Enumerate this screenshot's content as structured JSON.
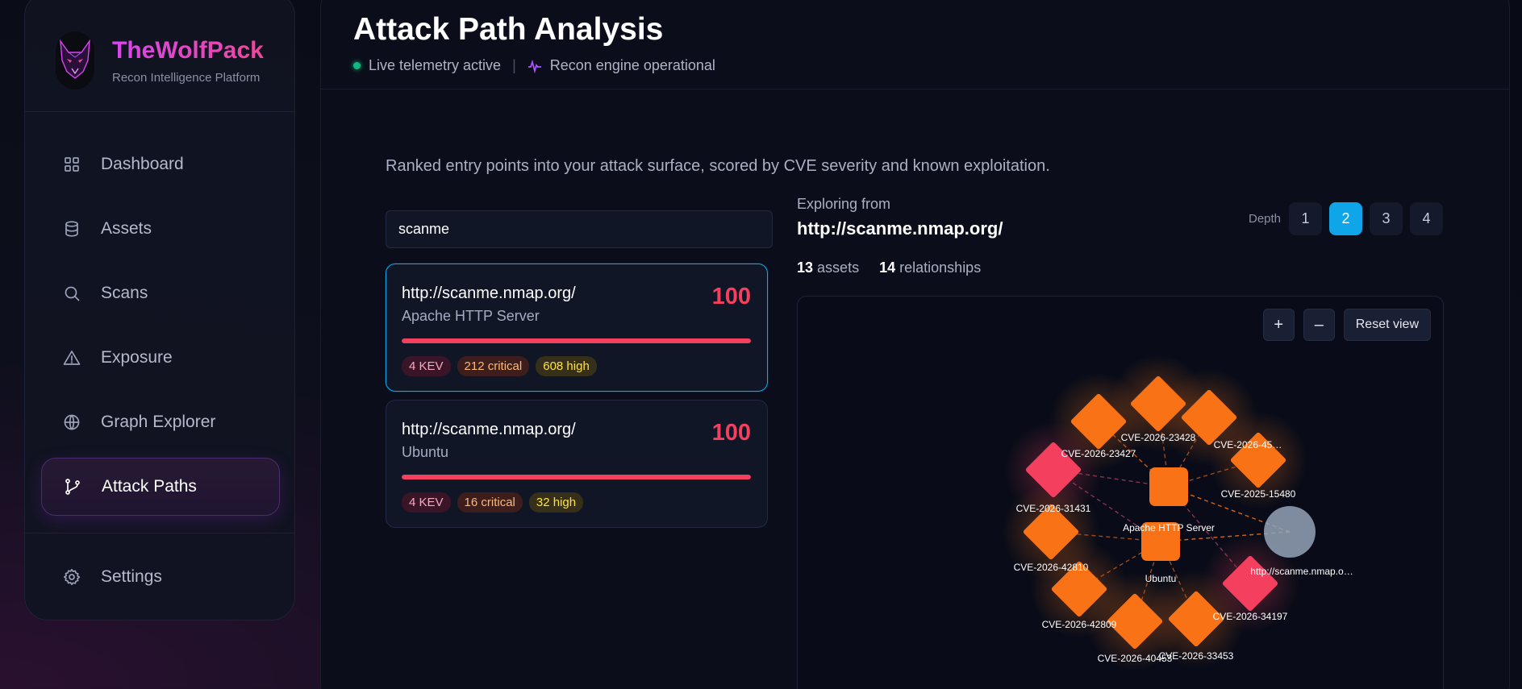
{
  "brand": {
    "name": "TheWolfPack",
    "tagline": "Recon Intelligence Platform"
  },
  "sidebar": {
    "items": [
      {
        "label": "Dashboard",
        "icon": "grid-icon"
      },
      {
        "label": "Assets",
        "icon": "database-icon"
      },
      {
        "label": "Scans",
        "icon": "search-icon"
      },
      {
        "label": "Exposure",
        "icon": "warning-icon"
      },
      {
        "label": "Graph Explorer",
        "icon": "globe-icon"
      },
      {
        "label": "Attack Paths",
        "icon": "git-branch-icon",
        "active": true
      }
    ],
    "settings": {
      "label": "Settings",
      "icon": "gear-icon"
    }
  },
  "header": {
    "title": "Attack Path Analysis",
    "status_live": "Live telemetry active",
    "separator": "|",
    "status_engine": "Recon engine operational"
  },
  "main": {
    "subtitle": "Ranked entry points into your attack surface, scored by CVE severity and known exploitation.",
    "search": {
      "value": "scanme",
      "placeholder": ""
    },
    "paths": [
      {
        "url": "http://scanme.nmap.org/",
        "tech": "Apache HTTP Server",
        "score": "100",
        "score_fraction": 1.0,
        "kev": "4 KEV",
        "critical": "212 critical",
        "high": "608 high",
        "selected": true
      },
      {
        "url": "http://scanme.nmap.org/",
        "tech": "Ubuntu",
        "score": "100",
        "score_fraction": 1.0,
        "kev": "4 KEV",
        "critical": "16 critical",
        "high": "32 high",
        "selected": false
      }
    ]
  },
  "explorer": {
    "label": "Exploring from",
    "url": "http://scanme.nmap.org/",
    "depth_label": "Depth",
    "depths": [
      "1",
      "2",
      "3",
      "4"
    ],
    "selected_depth": "2",
    "assets_count": "13",
    "assets_label": "assets",
    "relationships_count": "14",
    "relationships_label": "relationships",
    "controls": {
      "zoom_in": "+",
      "zoom_out": "–",
      "reset": "Reset view"
    }
  },
  "graph": {
    "colors": {
      "cve": "#f97316",
      "kev": "#f43f5e",
      "root": "#94a3b8",
      "edge": "#f97316"
    },
    "nodes": [
      {
        "id": "apache",
        "label": "Apache HTTP Server",
        "kind": "tech"
      },
      {
        "id": "ubuntu",
        "label": "Ubuntu",
        "kind": "tech"
      },
      {
        "id": "root",
        "label": "http://scanme.nmap.o…",
        "kind": "root"
      },
      {
        "id": "c23428",
        "label": "CVE-2026-23428",
        "kind": "cve"
      },
      {
        "id": "c23427",
        "label": "CVE-2026-23427",
        "kind": "cve"
      },
      {
        "id": "c45",
        "label": "CVE-2026-45…",
        "kind": "cve"
      },
      {
        "id": "c15480",
        "label": "CVE-2025-15480",
        "kind": "cve"
      },
      {
        "id": "c31431",
        "label": "CVE-2026-31431",
        "kind": "kev"
      },
      {
        "id": "c42810",
        "label": "CVE-2026-42810",
        "kind": "cve"
      },
      {
        "id": "c42809",
        "label": "CVE-2026-42809",
        "kind": "cve"
      },
      {
        "id": "c40453",
        "label": "CVE-2026-40453",
        "kind": "cve"
      },
      {
        "id": "c33453",
        "label": "CVE-2026-33453",
        "kind": "cve"
      },
      {
        "id": "c34197",
        "label": "CVE-2026-34197",
        "kind": "kev"
      },
      {
        "id": "ctop",
        "label": "",
        "kind": "cve"
      }
    ],
    "edges": [
      [
        "root",
        "apache"
      ],
      [
        "root",
        "ubuntu"
      ],
      [
        "apache",
        "c23428"
      ],
      [
        "apache",
        "c23427"
      ],
      [
        "apache",
        "c45"
      ],
      [
        "apache",
        "c15480"
      ],
      [
        "apache",
        "c31431"
      ],
      [
        "apache",
        "ctop"
      ],
      [
        "apache",
        "c34197"
      ],
      [
        "ubuntu",
        "c42810"
      ],
      [
        "ubuntu",
        "c42809"
      ],
      [
        "ubuntu",
        "c40453"
      ],
      [
        "ubuntu",
        "c33453"
      ],
      [
        "ubuntu",
        "c31431"
      ]
    ]
  }
}
